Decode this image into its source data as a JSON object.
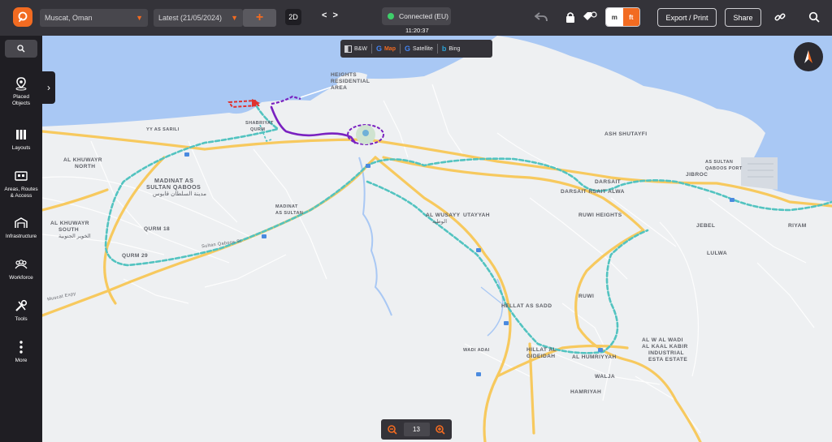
{
  "topbar": {
    "location_select": "Muscat, Oman",
    "date_select": "Latest (21/05/2024)",
    "add_label": "+",
    "view_mode": "2D",
    "nav_arrows": "< >",
    "connection_status": "Connected (EU)",
    "clock": "11:20:37",
    "unit_m": "m",
    "unit_ft": "ft",
    "export_label": "Export / Print",
    "share_label": "Share"
  },
  "sidebar": {
    "items": [
      {
        "label_line1": "Placed",
        "label_line2": "Objects",
        "icon": "pin-icon"
      },
      {
        "label_line1": "Layouts",
        "label_line2": "",
        "icon": "layouts-icon"
      },
      {
        "label_line1": "Areas, Routes",
        "label_line2": "& Access",
        "icon": "areas-icon"
      },
      {
        "label_line1": "Infrastructure",
        "label_line2": "",
        "icon": "infrastructure-icon"
      },
      {
        "label_line1": "Workforce",
        "label_line2": "",
        "icon": "workforce-icon"
      },
      {
        "label_line1": "Tools",
        "label_line2": "",
        "icon": "tools-icon"
      },
      {
        "label_line1": "More",
        "label_line2": "",
        "icon": "more-icon"
      }
    ]
  },
  "layers": {
    "bw": "B&W",
    "map": "Map",
    "satellite": "Satellite",
    "bing": "Bing",
    "active": "Map"
  },
  "zoom": {
    "level": "13"
  },
  "map_labels": {
    "heights_residential": [
      "HEIGHTS",
      "RESIDENTIAL",
      "AREA"
    ],
    "ash_shutayfi": "ASH SHUTAYFI",
    "jibroc": "JIBROC",
    "sultan_qaboos_port": [
      "AS SULTAN",
      "QABOOS PORT"
    ],
    "darsait": "DARSAIT",
    "darsait_rsait_alwa": "DARSAIT RSAIT ALWA",
    "ruwi_heights": "RUWI HEIGHTS",
    "jebel": "JEBEL",
    "riyam": "RIYAM",
    "lulwa": "LULWA",
    "al_khuwayr_north": [
      "AL KHUWAYR",
      "NORTH"
    ],
    "madinat_sultan_qaboos": [
      "MADINAT AS",
      "SULTAN QABOOS"
    ],
    "madinat_sultan_qaboos_ar": "مدينة السلطان قابوس",
    "qurm_18": "QURM 18",
    "qurm_29": "QURM 29",
    "al_khuwayr_south": [
      "AL KHUWAYR",
      "SOUTH"
    ],
    "al_khuwayr_south_ar": "الخوير الجنوبية",
    "madinat_as_sultan": [
      "MADINAT",
      "AS SULTAN"
    ],
    "al_wusayyi": "AL WUSAYY",
    "al_wusayyi_ar": "الوطية",
    "utayyah": "UTAYYAH",
    "hellat_as_sadd": "HELLAT AS SADD",
    "ruwi": "RUWI",
    "wadi_adai": "WADI ADAI",
    "hillat_gideidah": [
      "HILLAT AL",
      "GIDEIDAH"
    ],
    "al_humriyyah": "AL HUMRIYYAH",
    "walja": "WALJA",
    "hamriyah": "HAMRIYAH",
    "wadi_kabir": [
      "AL W AL WADI",
      "AL KAAL KABIR",
      "INDUSTRIAL",
      "ESTA ESTATE"
    ],
    "shabriyat_qurm": [
      "SHABRIYAT",
      "QURM"
    ],
    "yy_as_sarili": "YY AS SARILI",
    "muscat_expy": "Muscat Expy",
    "sultan_qaboos_st": "Sultan Qaboos St"
  }
}
